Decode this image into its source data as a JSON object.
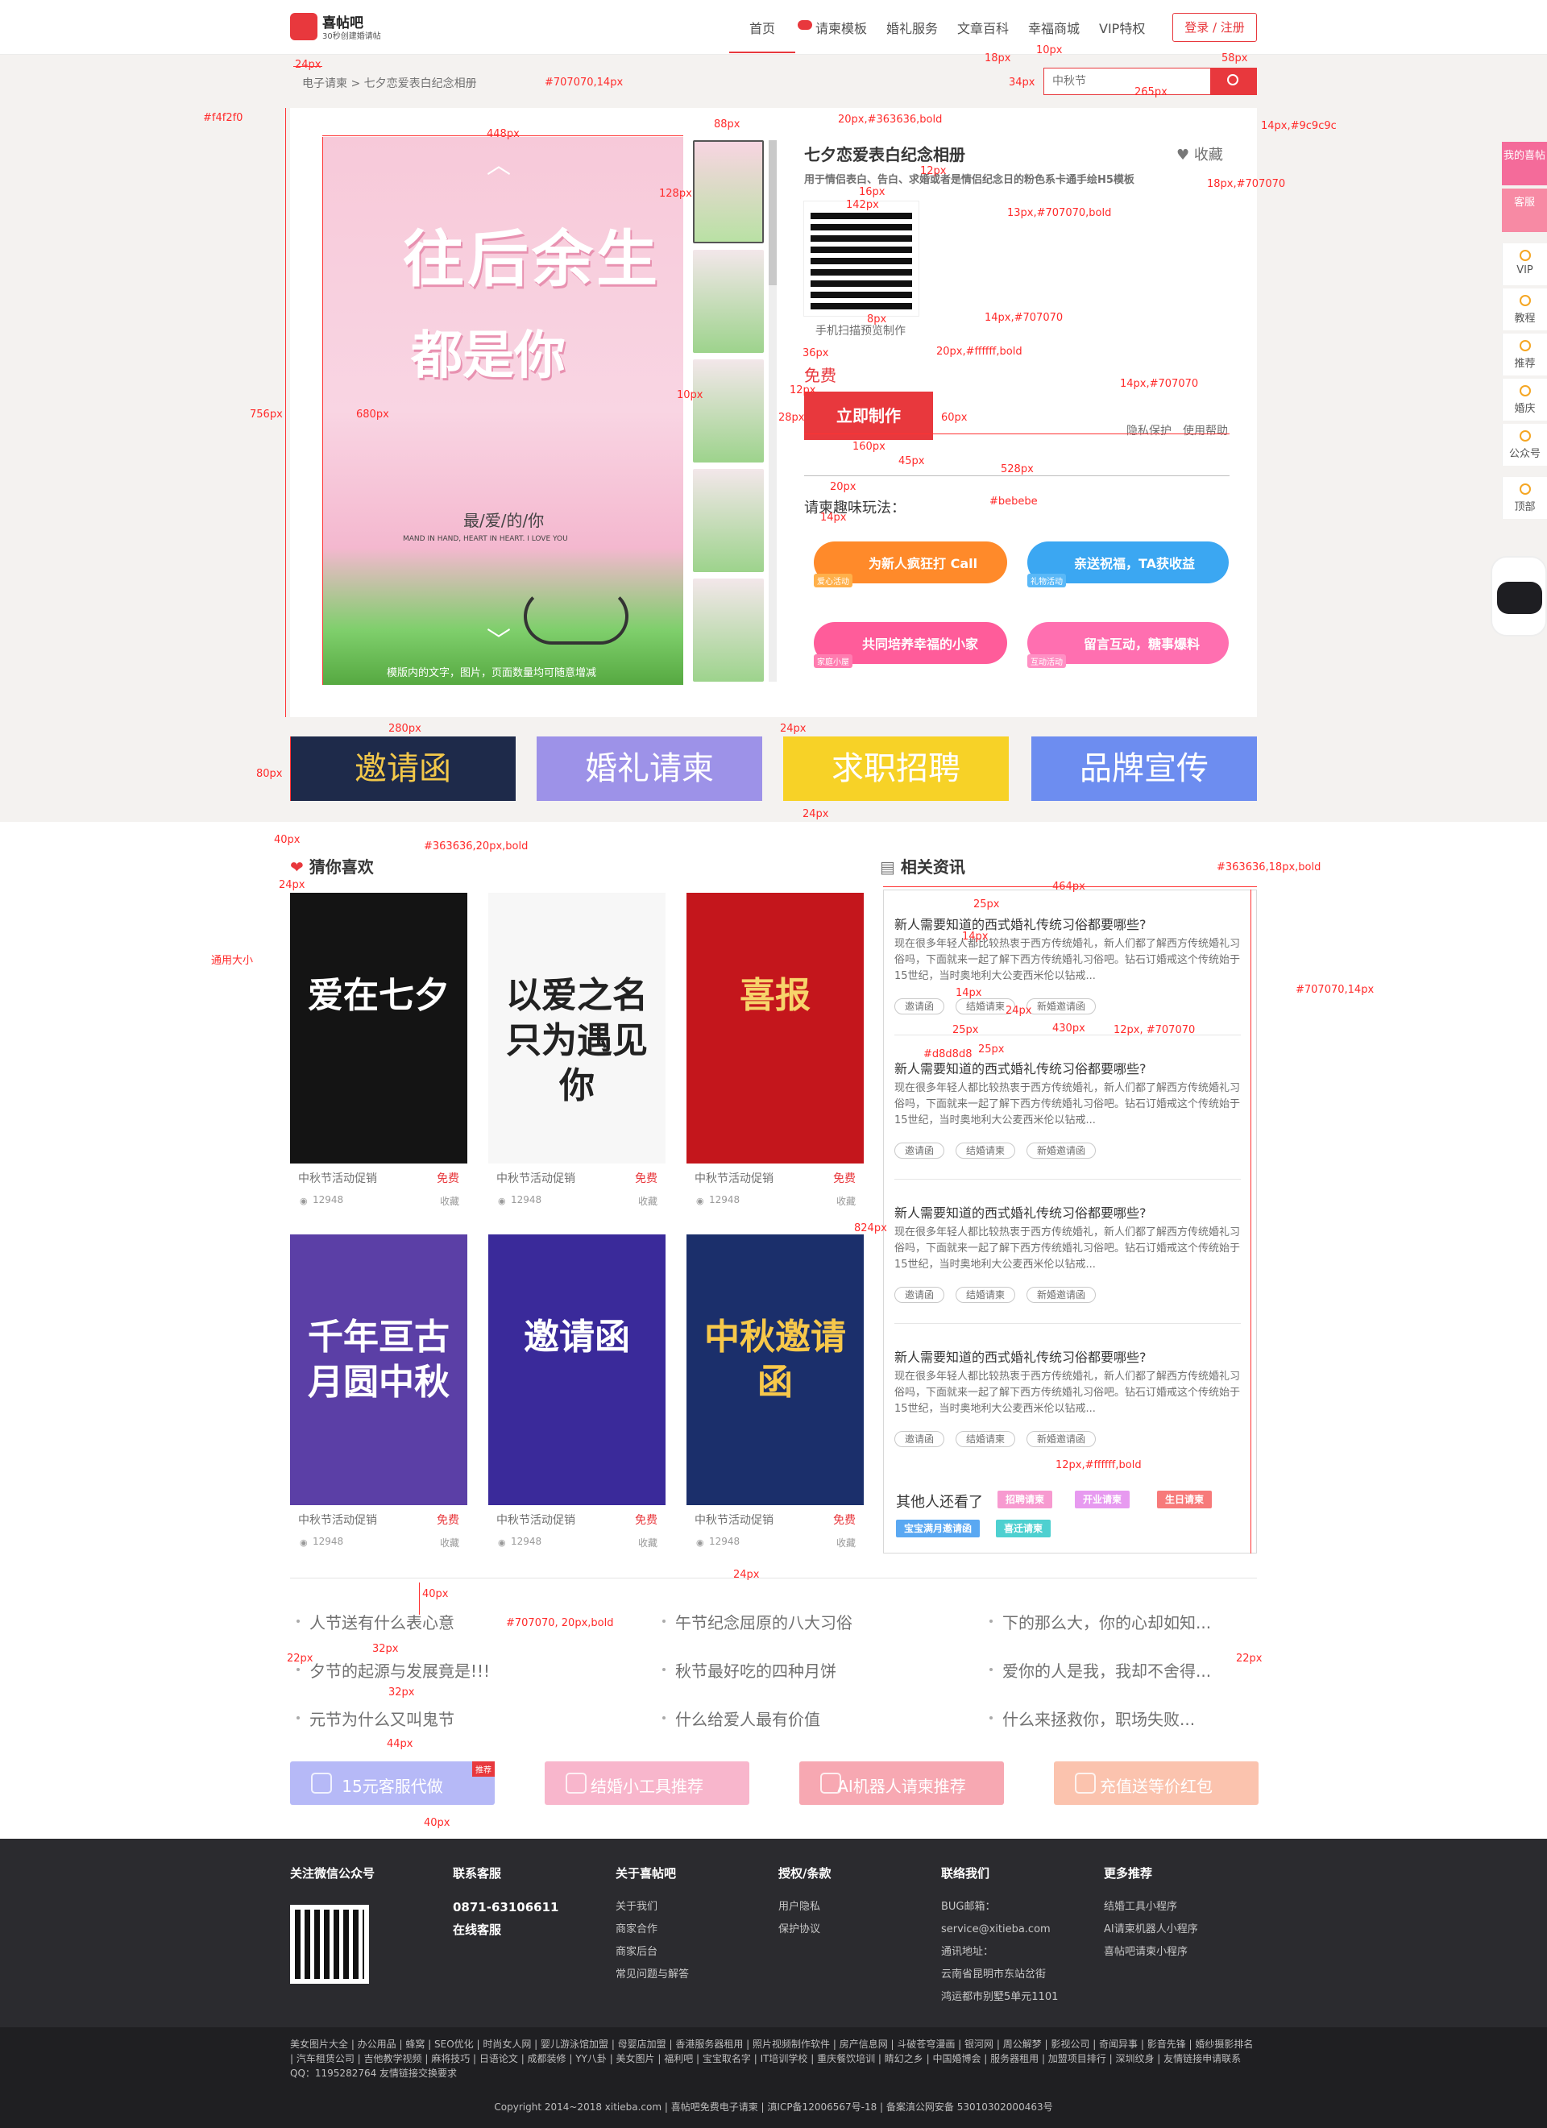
{
  "header": {
    "logo_name": "喜帖吧",
    "logo_tagline": "30秒创建婚请帖",
    "nav": [
      "首页",
      "请柬模板",
      "婚礼服务",
      "文章百科",
      "幸福商城",
      "VIP特权"
    ],
    "login": "登录 / 注册"
  },
  "search": {
    "placeholder": "中秋节",
    "icon": "search-icon"
  },
  "breadcrumb": {
    "root": "电子请柬",
    "sep": ">",
    "current": "七夕恋爱表白纪念相册"
  },
  "preview": {
    "big_top": "往后余生",
    "big_mid": "都是你",
    "sub": "最/爱/的/你",
    "small": "MAND IN HAND, HEART IN HEART. I LOVE YOU",
    "caption": "模版内的文字，图片，页面数量均可随意增减",
    "up": "︿",
    "down": "﹀"
  },
  "detail": {
    "title": "七夕恋爱表白纪念相册",
    "collect": "收藏",
    "desc": "用于情侣表白、告白、求婚或者是情侣纪念日的粉色系卡通手绘H5模板",
    "qr_caption": "手机扫描预览制作",
    "free": "免费",
    "make": "立即制作",
    "privacy": "隐私保护",
    "help": "使用帮助",
    "fun_title": "请柬趣味玩法：",
    "fun": [
      {
        "label": "为新人疯狂打 Call",
        "badge": "爱心活动",
        "color": "#ff8a2a"
      },
      {
        "label": "亲送祝福，TA获收益",
        "badge": "礼物活动",
        "color": "#3ba7f2"
      },
      {
        "label": "共同培养幸福的小家",
        "badge": "家庭小屋",
        "color": "#ff5c9a"
      },
      {
        "label": "留言互动，糖事爆料",
        "badge": "互动活动",
        "color": "#ff6fb0"
      }
    ]
  },
  "banners": [
    {
      "label": "邀请函",
      "bg": "#1e2a4a",
      "fg": "#f3c84a"
    },
    {
      "label": "婚礼请柬",
      "bg": "#9d92e8",
      "fg": "#ffffff"
    },
    {
      "label": "求职招聘",
      "bg": "#f7d227",
      "fg": "#ffffff"
    },
    {
      "label": "品牌宣传",
      "bg": "#6d8df0",
      "fg": "#ffffff"
    }
  ],
  "guess": {
    "title": "猜你喜欢",
    "items": [
      {
        "name": "中秋节活动促销",
        "price": "免费",
        "views": "12948",
        "collect": "收藏",
        "art": "爱在七夕",
        "bg": "#141414",
        "fg": "#ffffff"
      },
      {
        "name": "中秋节活动促销",
        "price": "免费",
        "views": "12948",
        "collect": "收藏",
        "art": "以爱之名 只为遇见你",
        "bg": "#f7f7f7",
        "fg": "#222222"
      },
      {
        "name": "中秋节活动促销",
        "price": "免费",
        "views": "12948",
        "collect": "收藏",
        "art": "喜报",
        "bg": "#c4161c",
        "fg": "#f7d46b"
      },
      {
        "name": "中秋节活动促销",
        "price": "免费",
        "views": "12948",
        "collect": "收藏",
        "art": "千年亘古月圆中秋",
        "bg": "#5b3fa6",
        "fg": "#ffffff"
      },
      {
        "name": "中秋节活动促销",
        "price": "免费",
        "views": "12948",
        "collect": "收藏",
        "art": "邀请函",
        "bg": "#3a2a9a",
        "fg": "#ffffff"
      },
      {
        "name": "中秋节活动促销",
        "price": "免费",
        "views": "12948",
        "collect": "收藏",
        "art": "中秋邀请函",
        "bg": "#1b2f6b",
        "fg": "#f7c84a"
      }
    ]
  },
  "news": {
    "title": "相关资讯",
    "items": [
      {
        "title": "新人需要知道的西式婚礼传统习俗都要哪些?",
        "body": "现在很多年轻人都比较热衷于西方传统婚礼，新人们都了解西方传统婚礼习俗吗，下面就来一起了解下西方传统婚礼习俗吧。钻石订婚戒这个传统始于15世纪，当时奥地利大公麦西米伦以钻戒...",
        "tags": [
          "邀请函",
          "结婚请柬",
          "新婚邀请函"
        ]
      },
      {
        "title": "新人需要知道的西式婚礼传统习俗都要哪些?",
        "body": "现在很多年轻人都比较热衷于西方传统婚礼，新人们都了解西方传统婚礼习俗吗，下面就来一起了解下西方传统婚礼习俗吧。钻石订婚戒这个传统始于15世纪，当时奥地利大公麦西米伦以钻戒...",
        "tags": [
          "邀请函",
          "结婚请柬",
          "新婚邀请函"
        ]
      },
      {
        "title": "新人需要知道的西式婚礼传统习俗都要哪些?",
        "body": "现在很多年轻人都比较热衷于西方传统婚礼，新人们都了解西方传统婚礼习俗吗，下面就来一起了解下西方传统婚礼习俗吧。钻石订婚戒这个传统始于15世纪，当时奥地利大公麦西米伦以钻戒...",
        "tags": [
          "邀请函",
          "结婚请柬",
          "新婚邀请函"
        ]
      },
      {
        "title": "新人需要知道的西式婚礼传统习俗都要哪些?",
        "body": "现在很多年轻人都比较热衷于西方传统婚礼，新人们都了解西方传统婚礼习俗吗，下面就来一起了解下西方传统婚礼习俗吧。钻石订婚戒这个传统始于15世纪，当时奥地利大公麦西米伦以钻戒...",
        "tags": [
          "邀请函",
          "结婚请柬",
          "新婚邀请函"
        ]
      }
    ],
    "others_title": "其他人还看了",
    "others": [
      {
        "label": "招聘请柬",
        "color": "#f79ad0"
      },
      {
        "label": "开业请柬",
        "color": "#e79af0"
      },
      {
        "label": "生日请柬",
        "color": "#f77a7a"
      },
      {
        "label": "宝宝满月邀请函",
        "color": "#5aa8f2"
      },
      {
        "label": "喜迁请柬",
        "color": "#4ed0d0"
      }
    ]
  },
  "links": [
    [
      "人节送有什么表心意",
      "午节纪念屈原的八大习俗",
      "下的那么大，你的心却如知..."
    ],
    [
      "夕节的起源与发展竟是!!!",
      "秋节最好吃的四种月饼",
      "爱你的人是我，我却不舍得..."
    ],
    [
      "元节为什么又叫鬼节",
      "什么给爱人最有价值",
      "什么来拯救你，职场失败..."
    ]
  ],
  "promo": [
    {
      "label": "15元客服代做",
      "bg": "#b6b9f7",
      "badge": "推荐"
    },
    {
      "label": "结婚小工具推荐",
      "bg": "#f8b6cc"
    },
    {
      "label": "AI机器人请柬推荐",
      "bg": "#f7a8b2"
    },
    {
      "label": "充值送等价红包",
      "bg": "#fbc3ae"
    }
  ],
  "footer": {
    "cols": [
      {
        "h": "关注微信公众号",
        "items": []
      },
      {
        "h": "联系客服",
        "items": [
          "0871-63106611",
          "在线客服"
        ]
      },
      {
        "h": "关于喜帖吧",
        "items": [
          "关于我们",
          "商家合作",
          "商家后台",
          "常见问题与解答"
        ]
      },
      {
        "h": "授权/条款",
        "items": [
          "用户隐私",
          "保护协议"
        ]
      },
      {
        "h": "联络我们",
        "items": [
          "BUG邮箱：",
          "service@xitieba.com",
          "通讯地址：",
          "云南省昆明市东站岔街",
          "鸿运都市别墅5单元1101"
        ]
      },
      {
        "h": "更多推荐",
        "items": [
          "结婚工具小程序",
          "AI请柬机器人小程序",
          "喜帖吧请柬小程序"
        ]
      }
    ],
    "friend_links": "美女图片大全 | 办公用品 | 蜂窝 | SEO优化 | 时尚女人网 | 婴儿游泳馆加盟 | 母婴店加盟 | 香港服务器租用 | 照片视频制作软件 | 房产信息网 | 斗破苍穹漫画 | 银河网 | 周公解梦 | 影视公司 | 奇闻异事 | 影音先锋 | 婚纱摄影排名 | 汽车租赁公司 | 吉他教学视频 | 麻将技巧 | 日语论文 | 成都装修 | YY八卦 | 美女图片 | 福利吧 | 宝宝取名字 | IT培训学校 | 重庆餐饮培训 | 睛幻之乡 | 中国婚博会 | 服务器租用 | 加盟项目排行 | 深圳纹身 | 友情链接申请联系QQ：1195282764 友情链接交换要求",
    "copyright": "Copyright 2014~2018 xitieba.com  |  喜帖吧免费电子请柬  |  滇ICP备12006567号-18  |  备案滇公网安备 53010302000463号"
  },
  "sidebar": [
    {
      "label": "我的喜帖",
      "bg": "#f46b9a",
      "fg": "#ffffff"
    },
    {
      "label": "客服",
      "bg": "#f78aa4",
      "fg": "#ffffff"
    },
    {
      "label": "VIP",
      "icon": "vip-icon"
    },
    {
      "label": "教程",
      "icon": "play-icon"
    },
    {
      "label": "推荐",
      "icon": "star-icon"
    },
    {
      "label": "婚庆",
      "icon": "heart-icon"
    },
    {
      "label": "公众号",
      "icon": "cloud-icon"
    },
    {
      "label": "顶部",
      "icon": "arrow-up-icon"
    }
  ],
  "annotations": [
    "24px",
    "#707070,14px",
    "18px",
    "10px",
    "58px",
    "34px",
    "265px",
    "14px,#9c9c9c",
    "#f4f2f0",
    "20px,#363636,bold",
    "448px",
    "88px",
    "18px,#707070",
    "12px",
    "13px,#707070,bold",
    "16px",
    "142px",
    "128px",
    "756px",
    "680px",
    "8px",
    "14px,#707070",
    "36px",
    "20px,#ffffff,bold",
    "12px",
    "10px",
    "28px",
    "160px",
    "60px",
    "14px,#707070",
    "45px",
    "528px",
    "20px",
    "#bebebe",
    "14px",
    "280px",
    "80px",
    "24px",
    "24px",
    "40px",
    "#363636,20px,bold",
    "24px",
    "通用大小",
    "#363636,18px,bold",
    "464px",
    "25px",
    "14px",
    "#707070,14px",
    "14px",
    "24px",
    "25px",
    "430px",
    "12px, #707070",
    "#d8d8d8",
    "25px",
    "824px",
    "12px,#ffffff,bold",
    "24px",
    "40px",
    "#707070, 20px,bold",
    "32px",
    "22px",
    "22px",
    "32px",
    "44px",
    "40px"
  ]
}
